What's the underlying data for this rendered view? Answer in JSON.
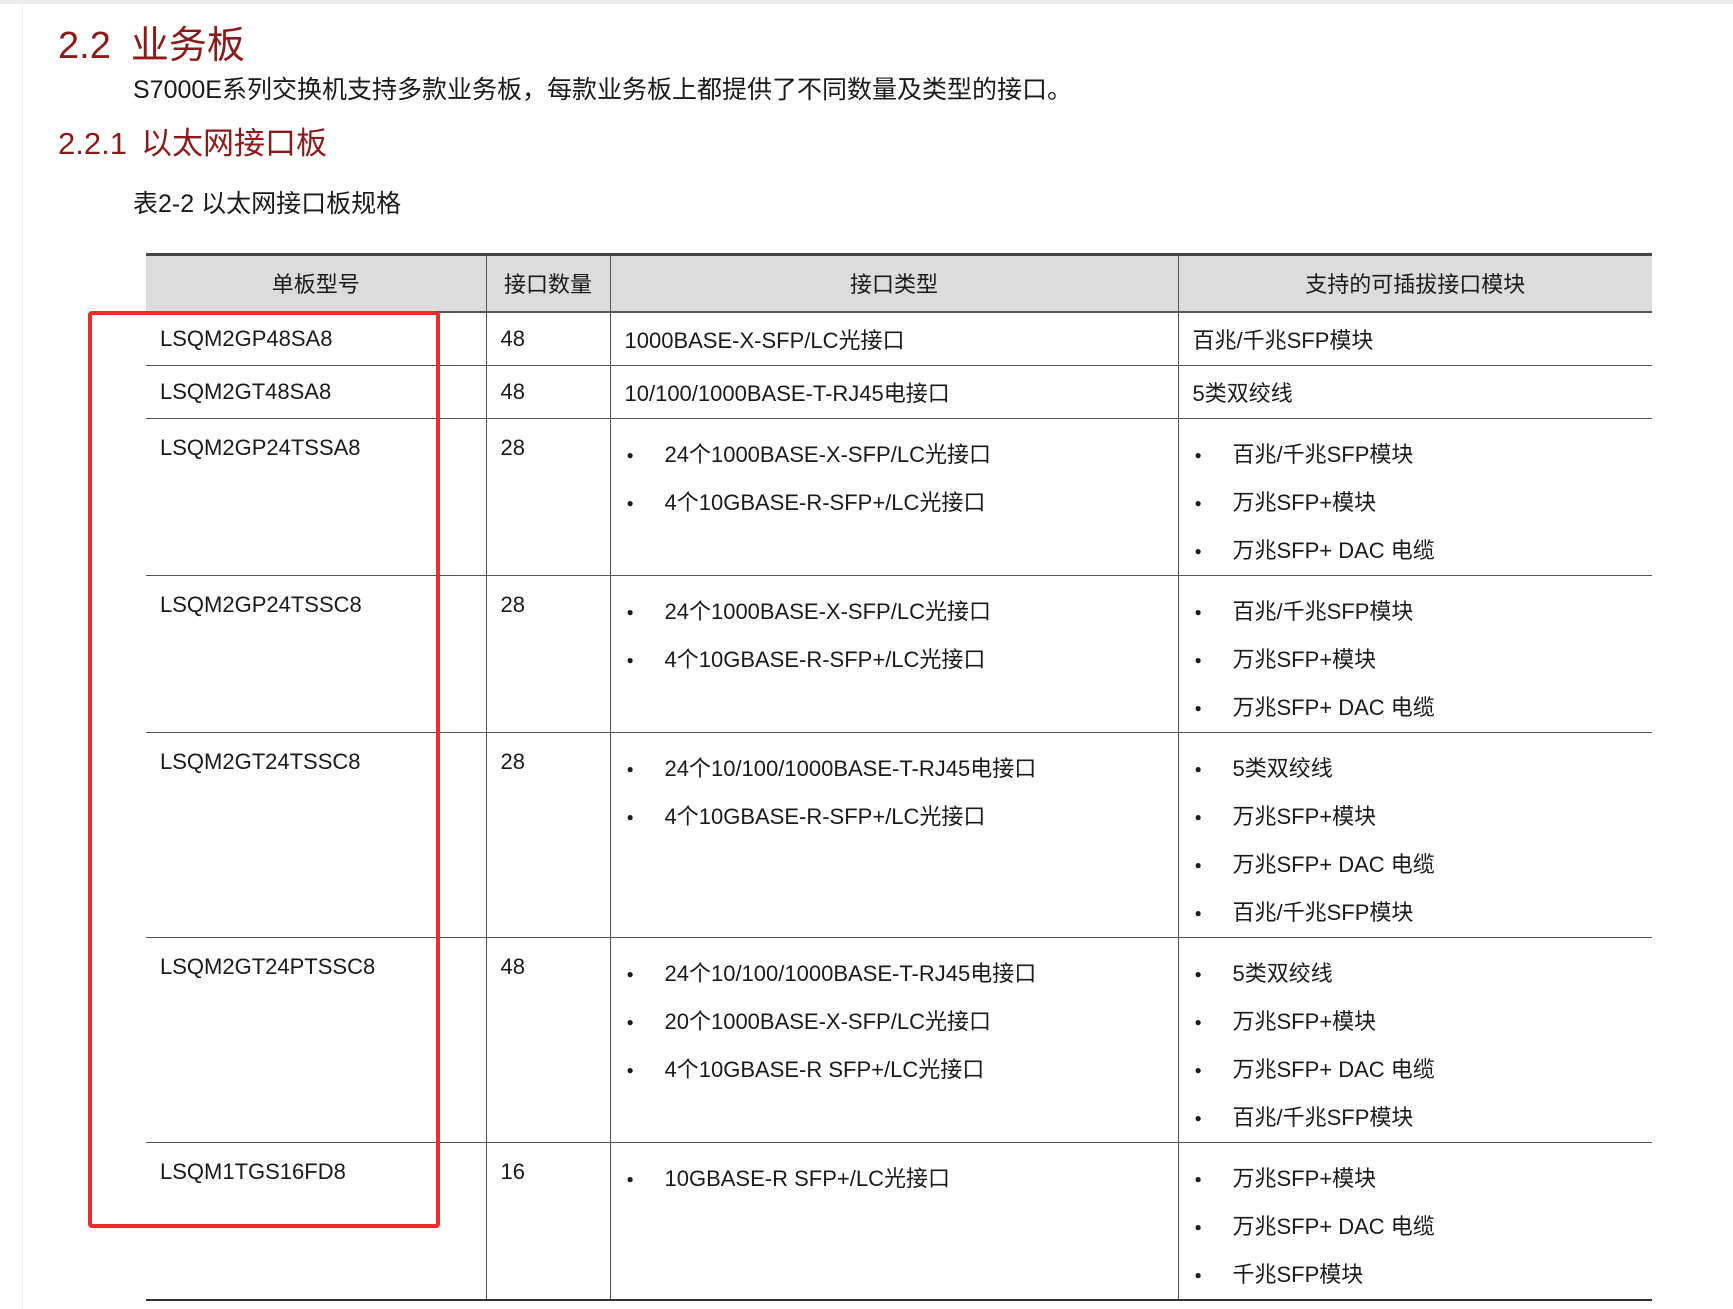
{
  "section": {
    "number": "2.2",
    "title": "业务板"
  },
  "intro": "S7000E系列交换机支持多款业务板，每款业务板上都提供了不同数量及类型的接口。",
  "subsection": {
    "number": "2.2.1",
    "title": "以太网接口板"
  },
  "caption": "表2-2 以太网接口板规格",
  "table": {
    "headers": [
      "单板型号",
      "接口数量",
      "接口类型",
      "支持的可插拔接口模块"
    ],
    "rows": [
      {
        "model": "LSQM2GP48SA8",
        "count": "48",
        "types": [
          "1000BASE-X-SFP/LC光接口"
        ],
        "modules": [
          "百兆/千兆SFP模块"
        ]
      },
      {
        "model": "LSQM2GT48SA8",
        "count": "48",
        "types": [
          "10/100/1000BASE-T-RJ45电接口"
        ],
        "modules": [
          "5类双绞线"
        ]
      },
      {
        "model": "LSQM2GP24TSSA8",
        "count": "28",
        "types": [
          "24个1000BASE-X-SFP/LC光接口",
          "4个10GBASE-R-SFP+/LC光接口"
        ],
        "modules": [
          "百兆/千兆SFP模块",
          "万兆SFP+模块",
          "万兆SFP+ DAC 电缆"
        ]
      },
      {
        "model": "LSQM2GP24TSSC8",
        "count": "28",
        "types": [
          "24个1000BASE-X-SFP/LC光接口",
          "4个10GBASE-R-SFP+/LC光接口"
        ],
        "modules": [
          "百兆/千兆SFP模块",
          "万兆SFP+模块",
          "万兆SFP+ DAC 电缆"
        ]
      },
      {
        "model": "LSQM2GT24TSSC8",
        "count": "28",
        "types": [
          "24个10/100/1000BASE-T-RJ45电接口",
          "4个10GBASE-R-SFP+/LC光接口"
        ],
        "modules": [
          "5类双绞线",
          "万兆SFP+模块",
          "万兆SFP+ DAC 电缆",
          "百兆/千兆SFP模块"
        ]
      },
      {
        "model": "LSQM2GT24PTSSC8",
        "count": "48",
        "types": [
          "24个10/100/1000BASE-T-RJ45电接口",
          "20个1000BASE-X-SFP/LC光接口",
          "4个10GBASE-R SFP+/LC光接口"
        ],
        "modules": [
          "5类双绞线",
          "万兆SFP+模块",
          "万兆SFP+ DAC 电缆",
          "百兆/千兆SFP模块"
        ]
      },
      {
        "model": "LSQM1TGS16FD8",
        "count": "16",
        "types": [
          "10GBASE-R SFP+/LC光接口"
        ],
        "modules": [
          "万兆SFP+模块",
          "万兆SFP+ DAC 电缆",
          "千兆SFP模块"
        ]
      }
    ]
  },
  "highlight": {
    "color": "#ee2b2b"
  }
}
